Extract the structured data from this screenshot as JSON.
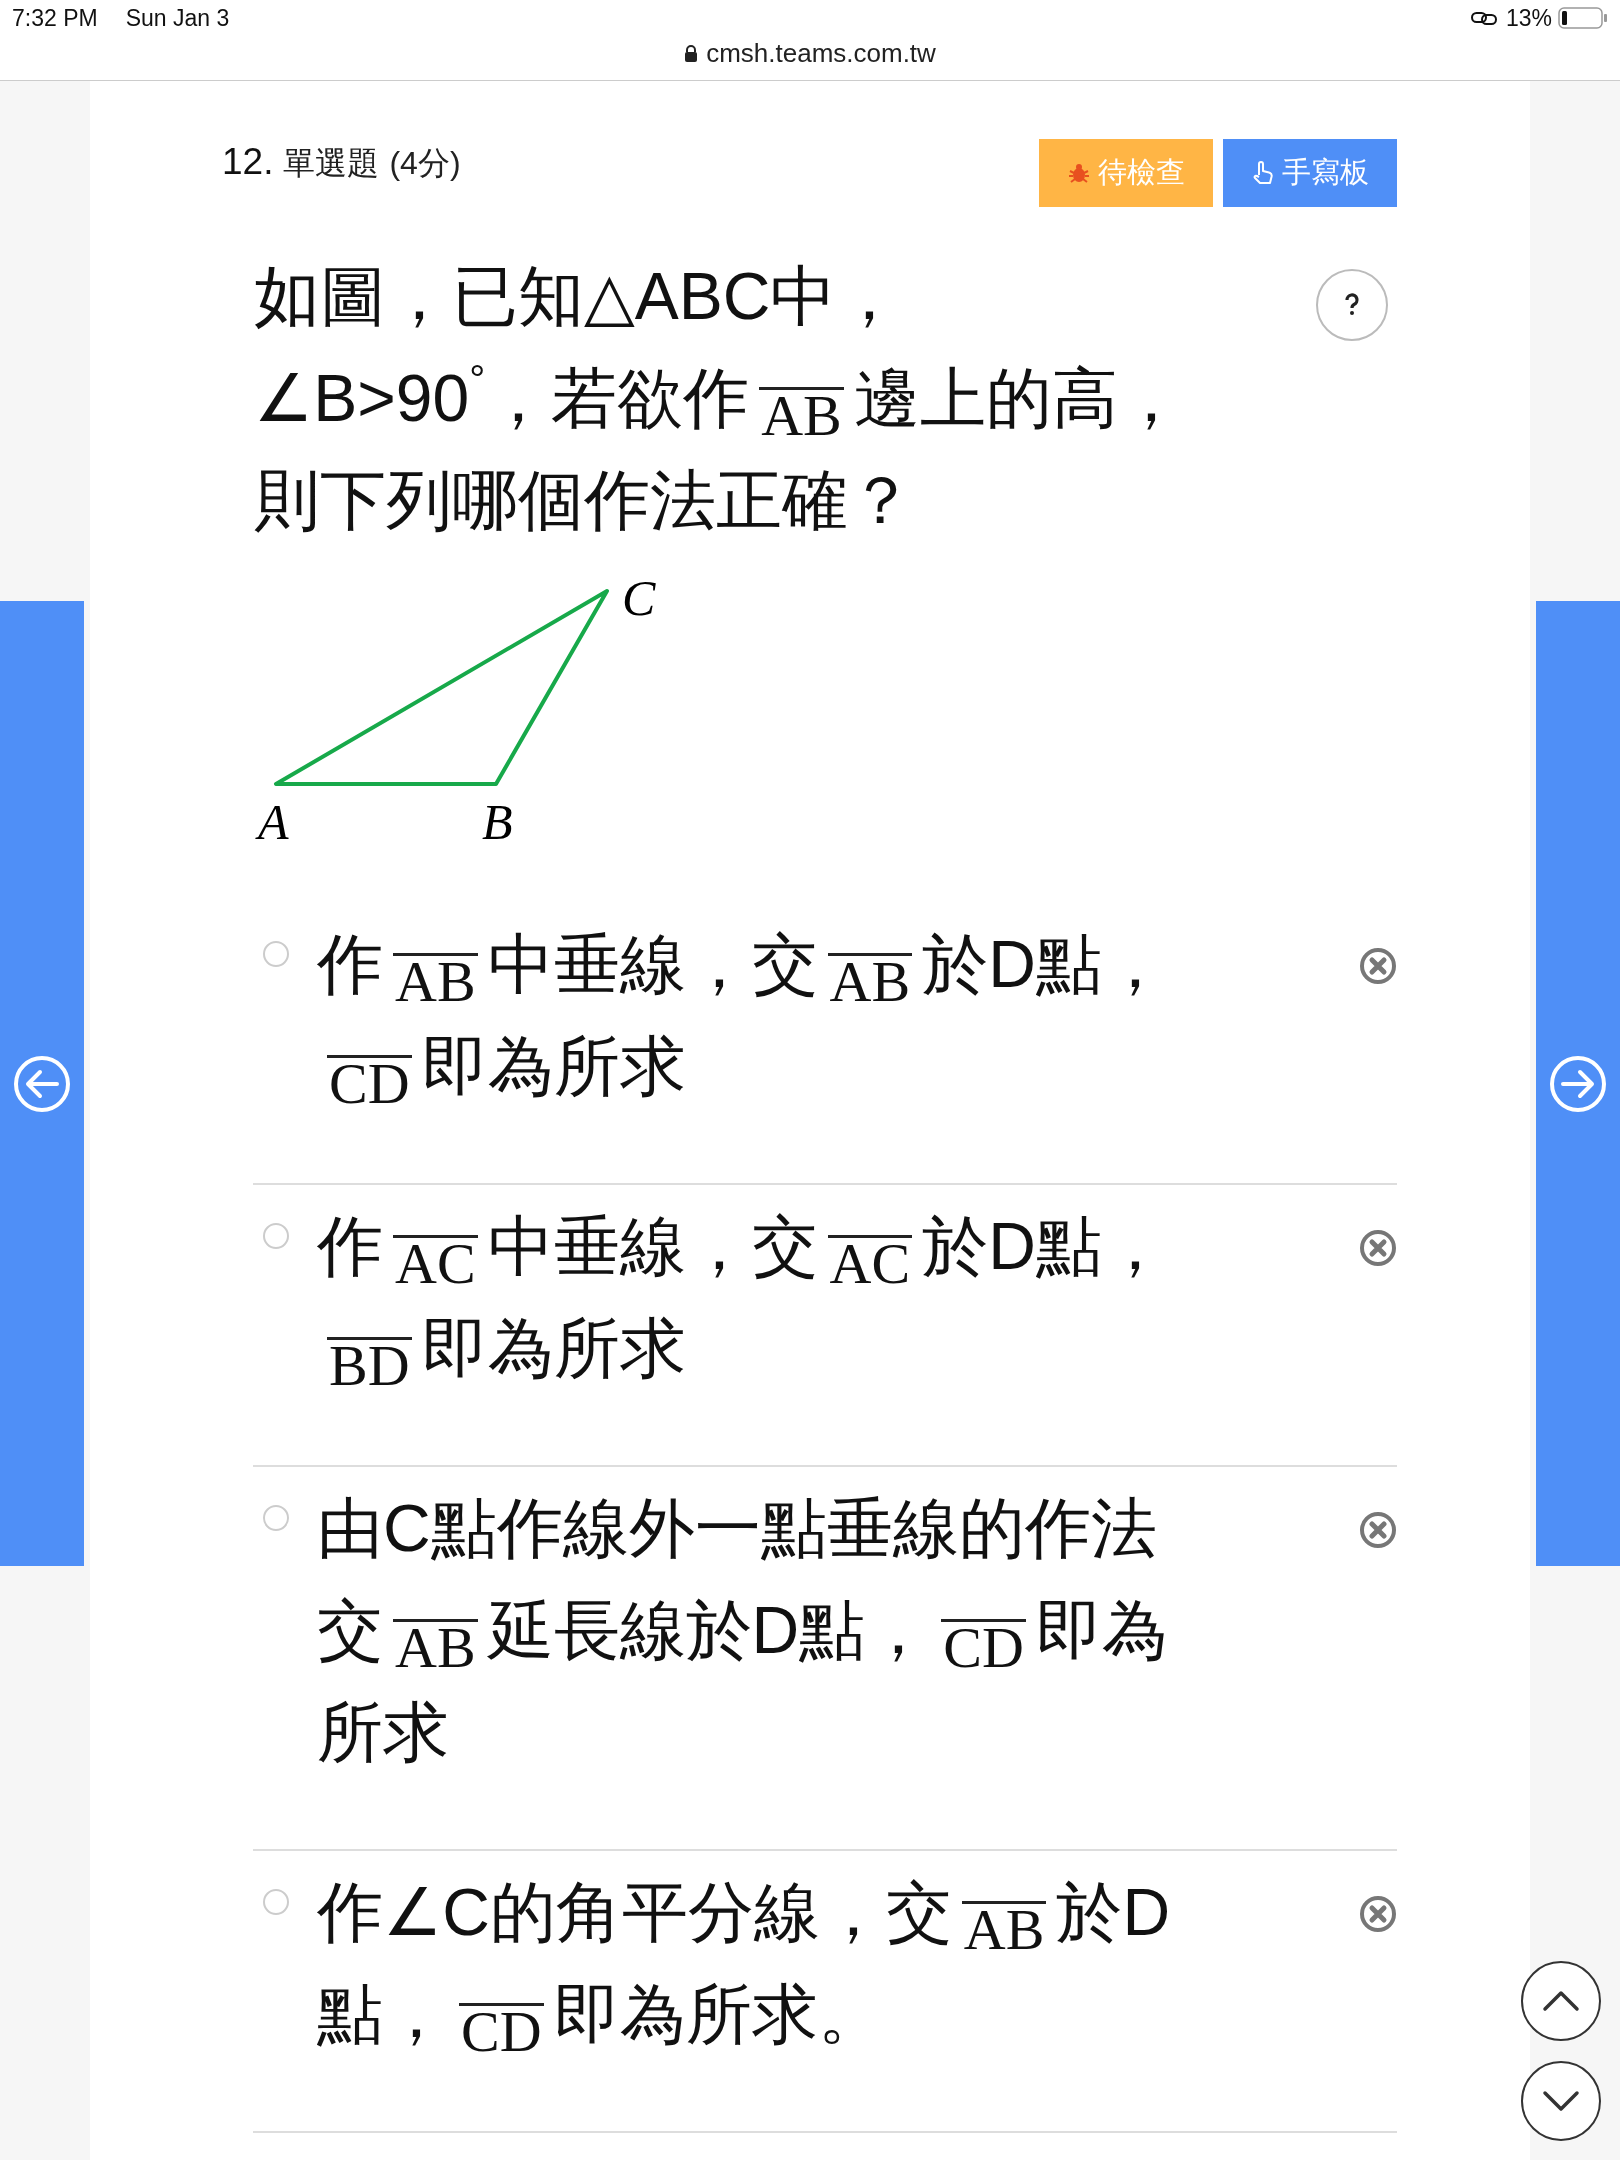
{
  "status_bar": {
    "time": "7:32 PM",
    "date": "Sun Jan 3",
    "url": "cmsh.teams.com.tw",
    "battery": "13%"
  },
  "question": {
    "number": "12.",
    "type": "單選題",
    "points": "(4分)",
    "buttons": [
      {
        "label": "待檢查",
        "kind": "review"
      },
      {
        "label": "手寫板",
        "kind": "handwriting"
      }
    ],
    "lines": [
      [
        {
          "kind": "text",
          "text": "如圖，已知△ABC中，"
        }
      ],
      [
        {
          "kind": "text",
          "text": "∠B>90"
        },
        {
          "kind": "sup",
          "text": "°"
        },
        {
          "kind": "text",
          "text": "，若欲作"
        },
        {
          "kind": "segment",
          "text": "AB"
        },
        {
          "kind": "text",
          "text": "邊上的高，"
        }
      ],
      [
        {
          "kind": "text",
          "text": "則下列哪個作法正確？"
        }
      ]
    ],
    "figure": {
      "labels": [
        "A",
        "B",
        "C"
      ]
    }
  },
  "options": [
    {
      "selected": false,
      "lines": [
        [
          {
            "kind": "text",
            "text": "作"
          },
          {
            "kind": "segment",
            "text": "AB"
          },
          {
            "kind": "text",
            "text": "中垂線，交"
          },
          {
            "kind": "segment",
            "text": "AB"
          },
          {
            "kind": "text",
            "text": "於D點，"
          }
        ],
        [
          {
            "kind": "segment",
            "text": "CD"
          },
          {
            "kind": "text",
            "text": "即為所求"
          }
        ]
      ]
    },
    {
      "selected": false,
      "lines": [
        [
          {
            "kind": "text",
            "text": "作"
          },
          {
            "kind": "segment",
            "text": "AC"
          },
          {
            "kind": "text",
            "text": "中垂線，交"
          },
          {
            "kind": "segment",
            "text": "AC"
          },
          {
            "kind": "text",
            "text": "於D點，"
          }
        ],
        [
          {
            "kind": "segment",
            "text": "BD"
          },
          {
            "kind": "text",
            "text": "即為所求"
          }
        ]
      ]
    },
    {
      "selected": false,
      "lines": [
        [
          {
            "kind": "text",
            "text": "由C點作線外一點垂線的作法"
          }
        ],
        [
          {
            "kind": "text",
            "text": "交"
          },
          {
            "kind": "segment",
            "text": "AB"
          },
          {
            "kind": "text",
            "text": "延長線於D點，"
          },
          {
            "kind": "segment",
            "text": "CD"
          },
          {
            "kind": "text",
            "text": "即為"
          }
        ],
        [
          {
            "kind": "text",
            "text": "所求"
          }
        ]
      ]
    },
    {
      "selected": false,
      "lines": [
        [
          {
            "kind": "text",
            "text": "作∠C的角平分線，交"
          },
          {
            "kind": "segment",
            "text": "AB"
          },
          {
            "kind": "text",
            "text": "於D"
          }
        ],
        [
          {
            "kind": "text",
            "text": "點，"
          },
          {
            "kind": "segment",
            "text": "CD"
          },
          {
            "kind": "text",
            "text": "即為所求。"
          }
        ]
      ]
    }
  ]
}
